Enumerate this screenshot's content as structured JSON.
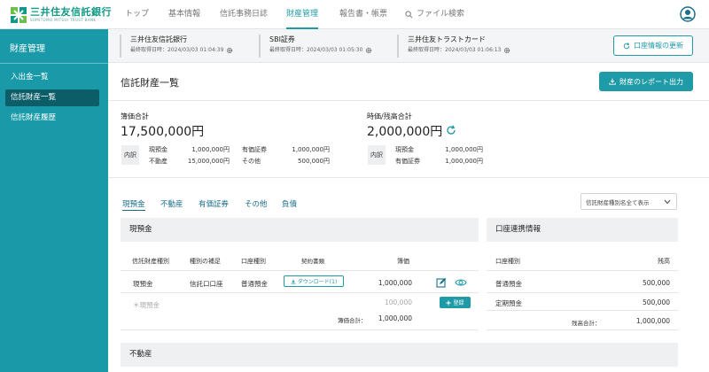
{
  "brand": {
    "name": "三井住友信託銀行",
    "subtitle": "SUMITOMO MITSUI TRUST BANK",
    "color": "#129a86"
  },
  "accent": "#1f9aa7",
  "nav": {
    "items": [
      "トップ",
      "基本情報",
      "信託事務日誌",
      "財産管理",
      "報告書・帳票"
    ],
    "active": "財産管理",
    "search": "ファイル検索"
  },
  "sidebar": {
    "title": "財産管理",
    "items": [
      {
        "label": "入出金一覧"
      },
      {
        "label": "信託財産一覧",
        "active": true
      },
      {
        "label": "信託財産履歴"
      }
    ]
  },
  "accounts": [
    {
      "name": "三井住友信託銀行",
      "date": "最終取得日時：2024/03/03 01:04:39"
    },
    {
      "name": "SBI証券",
      "date": "最終取得日時：2024/03/03 01:05:30"
    },
    {
      "name": "三井住友トラストカード",
      "date": "最終取得日時：2024/03/03 01:06:13"
    }
  ],
  "refresh_button": "口座情報の更新",
  "page": {
    "title": "信託財産一覧",
    "report_button": "財産のレポート出力"
  },
  "summary": {
    "book": {
      "label": "簿価合計",
      "value": "17,500,000円",
      "tag": "内訳",
      "rows": [
        {
          "k1": "現預金",
          "v1": "1,000,000円",
          "k2": "有価証券",
          "v2": "1,000,000円"
        },
        {
          "k1": "不動産",
          "v1": "15,000,000円",
          "k2": "その他",
          "v2": "500,000円"
        }
      ]
    },
    "market": {
      "label": "時価/残高合計",
      "value": "2,000,000円",
      "tag": "内訳",
      "rows": [
        {
          "k": "現預金",
          "v": "1,000,000円"
        },
        {
          "k": "有価証券",
          "v": "1,000,000円"
        }
      ]
    }
  },
  "tabs": [
    "現預金",
    "不動産",
    "有価証券",
    "その他",
    "負債"
  ],
  "filter": "信託財産種別名全て表示",
  "cash_panel": {
    "title": "現預金",
    "headers": [
      "信託財産種別",
      "種別の補足",
      "口座種別",
      "契約書類",
      "簿価"
    ],
    "row": {
      "type": "現預金",
      "note": "信託口口座",
      "account": "普通預金",
      "download": "ダウンロード(1)",
      "value": "1,000,000"
    },
    "placeholder": {
      "type": "＊現預金",
      "value": "100,000",
      "button": "登録"
    },
    "total": {
      "label": "簿価合計：",
      "value": "1,000,000"
    }
  },
  "link_panel": {
    "title": "口座連携情報",
    "headers": [
      "口座種別",
      "残高"
    ],
    "rows": [
      {
        "type": "普通預金",
        "value": "500,000"
      },
      {
        "type": "定期預金",
        "value": "500,000"
      }
    ],
    "total": {
      "label": "残高合計：",
      "value": "1,000,000"
    }
  },
  "realestate_panel": {
    "title": "不動産"
  }
}
